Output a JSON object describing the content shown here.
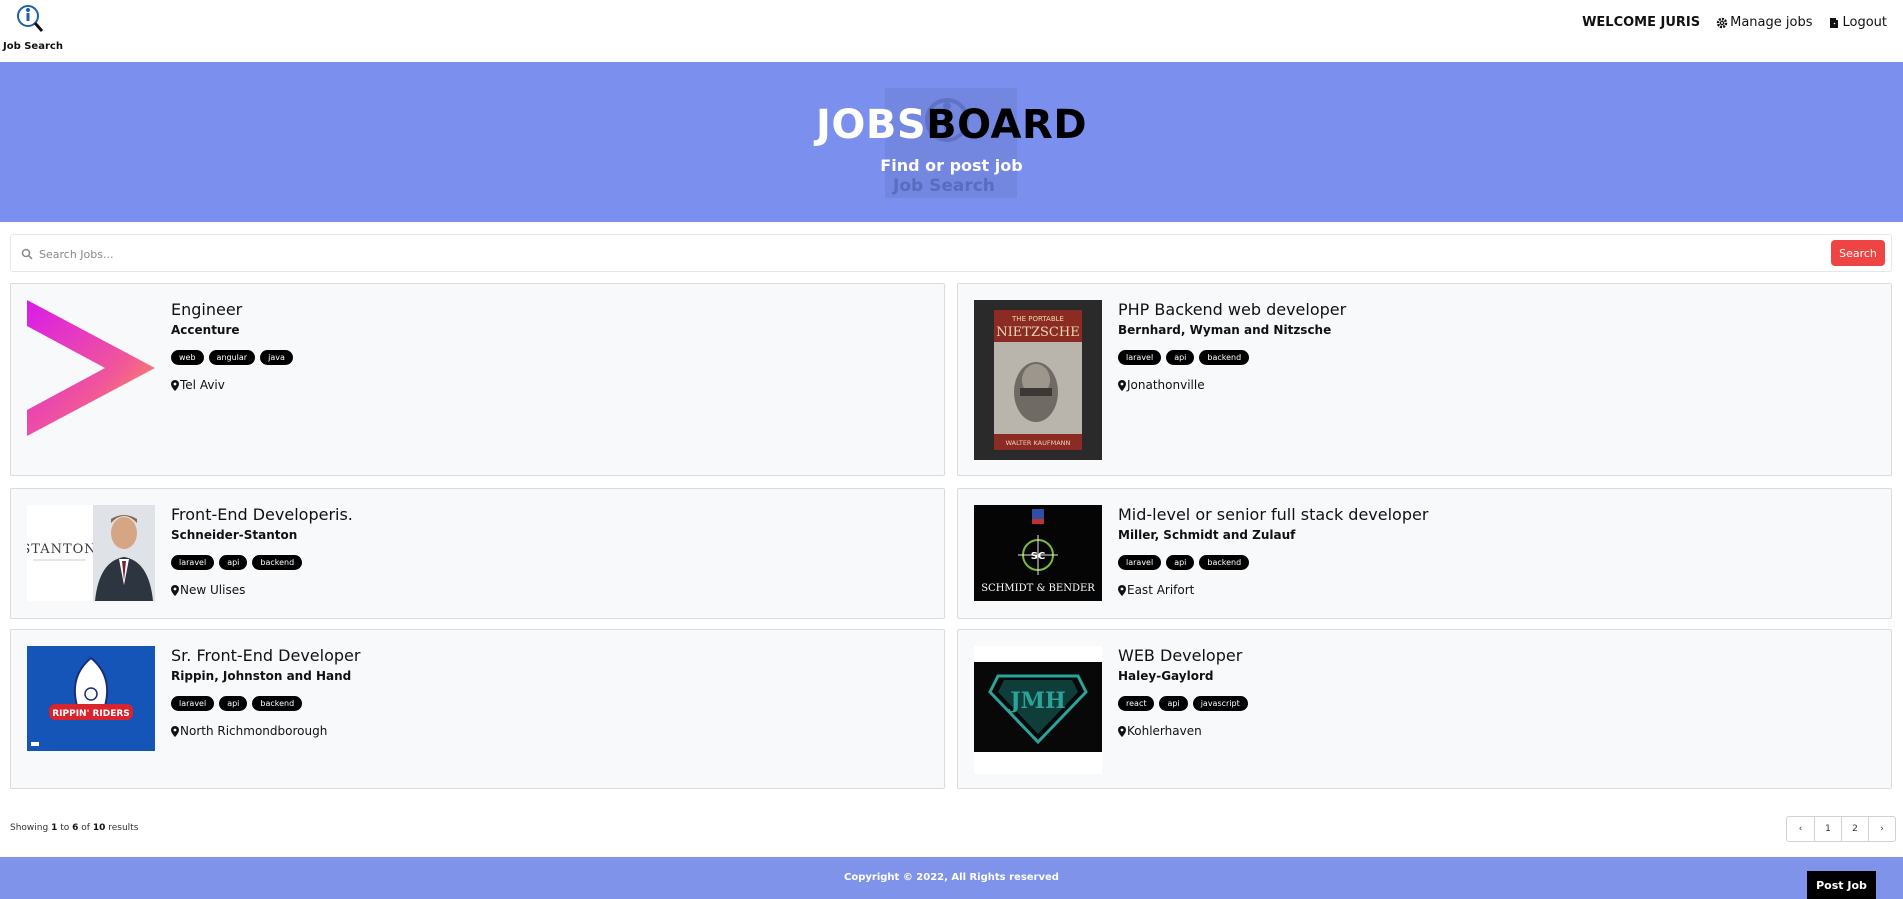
{
  "header": {
    "logo_text": "Job Search",
    "welcome": "WELCOME JURIS",
    "manage_jobs": "Manage jobs",
    "logout": "Logout"
  },
  "hero": {
    "title_part1": "JOBS",
    "title_part2": "BOARD",
    "subtitle": "Find or post job",
    "watermark_text": "Job Search"
  },
  "search": {
    "placeholder": "Search Jobs...",
    "value": "",
    "button_label": "Search"
  },
  "jobs": [
    {
      "title": "Engineer",
      "company": "Accenture",
      "tags": [
        "web",
        "angular",
        "java"
      ],
      "location": "Tel Aviv",
      "logo": "accenture-logo"
    },
    {
      "title": "PHP Backend web developer",
      "company": "Bernhard, Wyman and Nitzsche",
      "tags": [
        "laravel",
        "api",
        "backend"
      ],
      "location": "Jonathonville",
      "logo": "nietzsche-book-cover",
      "logo_text_top": "THE PORTABLE",
      "logo_text_main": "NIETZSCHE",
      "logo_text_bottom": "WALTER KAUFMANN"
    },
    {
      "title": "Front-End Developeris.",
      "company": "Schneider-Stanton",
      "tags": [
        "laravel",
        "api",
        "backend"
      ],
      "location": "New Ulises",
      "logo": "stanton-logo",
      "logo_text_main": "STANTON"
    },
    {
      "title": "Mid-level or senior full stack developer",
      "company": "Miller, Schmidt and Zulauf",
      "tags": [
        "laravel",
        "api",
        "backend"
      ],
      "location": "East Arifort",
      "logo": "schmidt-bender-logo",
      "logo_text_main": "SCHMIDT & BENDER",
      "logo_text_top": "SC"
    },
    {
      "title": "Sr. Front-End Developer",
      "company": "Rippin, Johnston and Hand",
      "tags": [
        "laravel",
        "api",
        "backend"
      ],
      "location": "North Richmondborough",
      "logo": "rippin-riders-logo",
      "logo_text_main": "RIPPIN' RIDERS"
    },
    {
      "title": "WEB Developer",
      "company": "Haley-Gaylord",
      "tags": [
        "react",
        "api",
        "javascript"
      ],
      "location": "Kohlerhaven",
      "logo": "jmh-logo",
      "logo_text_main": "JMH"
    }
  ],
  "pagination": {
    "showing": "Showing",
    "from": "1",
    "to_word": "to",
    "to": "6",
    "of_word": "of",
    "total": "10",
    "results_word": "results",
    "pages": [
      "1",
      "2"
    ],
    "prev": "‹",
    "next": "›"
  },
  "footer": {
    "copyright": "Copyright © 2022, All Rights reserved",
    "post_job": "Post Job"
  },
  "colors": {
    "hero_bg": "#7b8fee",
    "footer_bg": "#8093ea",
    "search_button": "#ef4444",
    "tag_bg": "#000000"
  }
}
